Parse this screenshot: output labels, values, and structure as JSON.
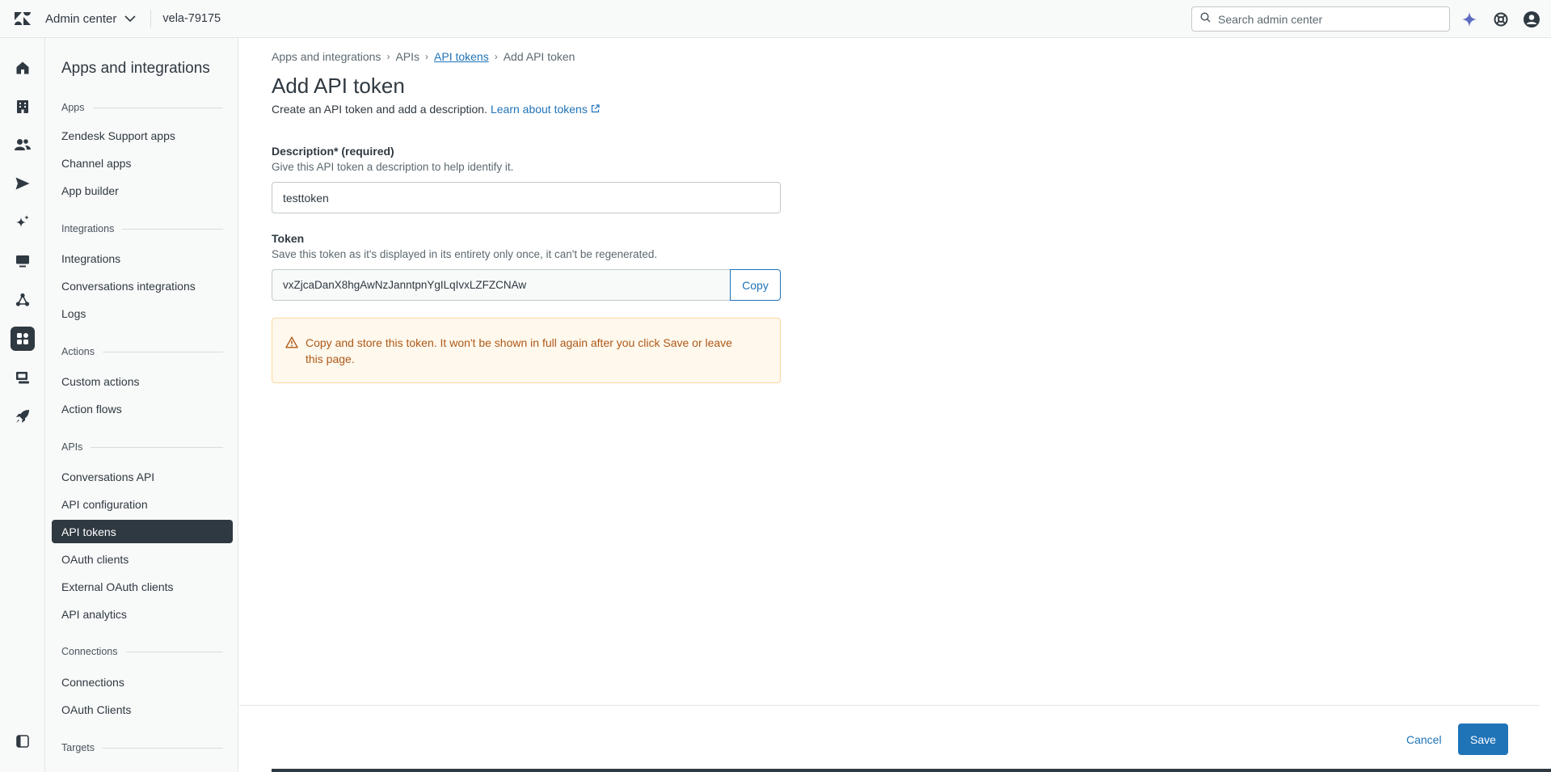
{
  "topbar": {
    "product": "Admin center",
    "account": "vela-79175",
    "search_placeholder": "Search admin center"
  },
  "sidebar": {
    "title": "Apps and integrations",
    "sections": [
      {
        "heading": "Apps",
        "items": [
          "Zendesk Support apps",
          "Channel apps",
          "App builder"
        ]
      },
      {
        "heading": "Integrations",
        "items": [
          "Integrations",
          "Conversations integrations",
          "Logs"
        ]
      },
      {
        "heading": "Actions",
        "items": [
          "Custom actions",
          "Action flows"
        ]
      },
      {
        "heading": "APIs",
        "items": [
          "Conversations API",
          "API configuration",
          "API tokens",
          "OAuth clients",
          "External OAuth clients",
          "API analytics"
        ]
      },
      {
        "heading": "Connections",
        "items": [
          "Connections",
          "OAuth Clients"
        ]
      },
      {
        "heading": "Targets",
        "items": []
      }
    ],
    "active_item": "API tokens"
  },
  "breadcrumb": {
    "items": [
      "Apps and integrations",
      "APIs",
      "API tokens",
      "Add API token"
    ]
  },
  "page": {
    "title": "Add API token",
    "subtitle": "Create an API token and add a description.",
    "learn_link": "Learn about tokens"
  },
  "form": {
    "description_label": "Description* (required)",
    "description_hint": "Give this API token a description to help identify it.",
    "description_value": "testtoken",
    "token_label": "Token",
    "token_hint": "Save this token as it's displayed in its entirety only once, it can't be regenerated.",
    "token_value": "vxZjcaDanX8hgAwNzJanntpnYgILqIvxLZFZCNAw",
    "copy_label": "Copy",
    "alert_text": "Copy and store this token. It won't be shown in full again after you click Save or leave this page."
  },
  "footer": {
    "cancel_label": "Cancel",
    "save_label": "Save"
  },
  "colors": {
    "accent": "#1f73b7",
    "dark": "#2f3941",
    "warning_text": "#ad5918",
    "warning_bg": "#fff8ed"
  }
}
